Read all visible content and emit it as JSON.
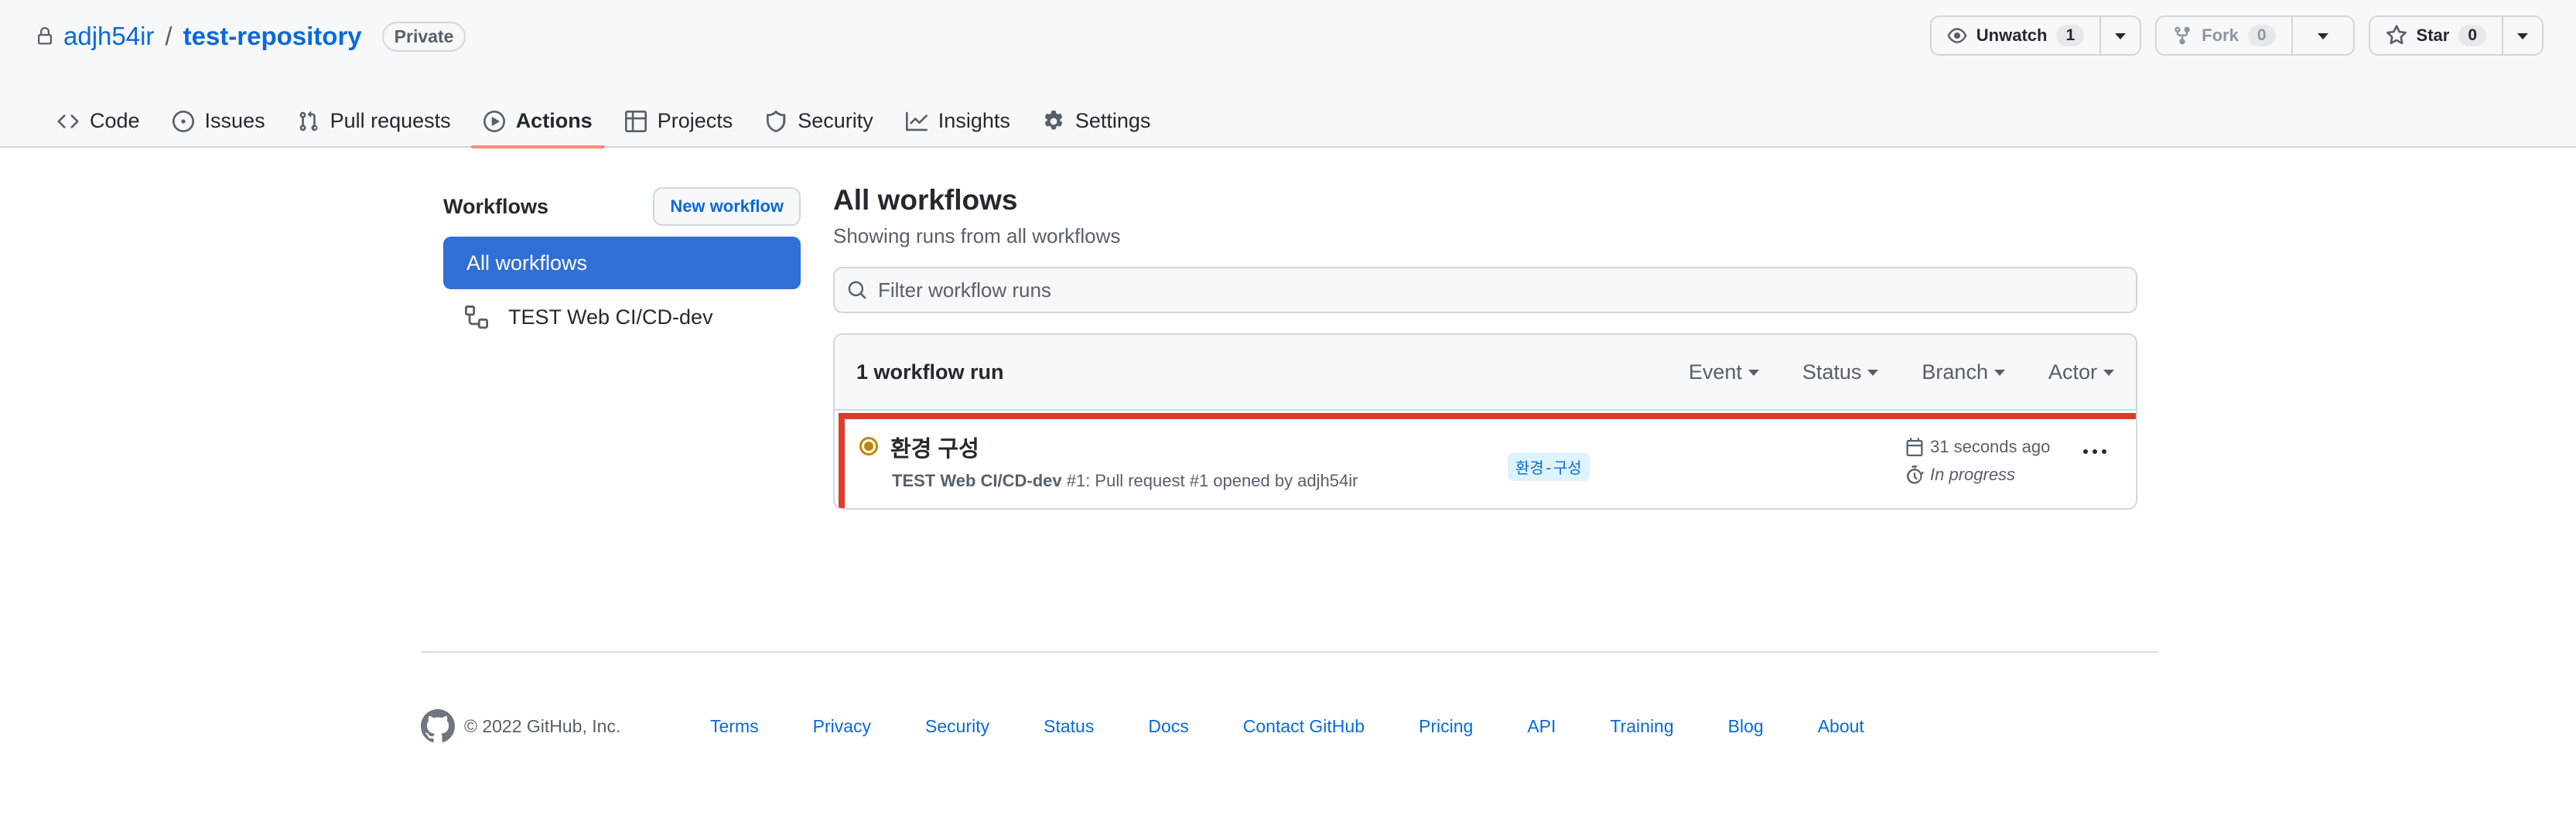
{
  "repo": {
    "owner": "adjh54ir",
    "separator": "/",
    "name": "test-repository",
    "visibility": "Private"
  },
  "header_actions": {
    "watch": {
      "label": "Unwatch",
      "count": "1"
    },
    "fork": {
      "label": "Fork",
      "count": "0"
    },
    "star": {
      "label": "Star",
      "count": "0"
    }
  },
  "tabs": [
    {
      "label": "Code",
      "icon": "code-icon"
    },
    {
      "label": "Issues",
      "icon": "issue-opened-icon"
    },
    {
      "label": "Pull requests",
      "icon": "git-pull-request-icon"
    },
    {
      "label": "Actions",
      "icon": "play-icon",
      "selected": true
    },
    {
      "label": "Projects",
      "icon": "table-icon"
    },
    {
      "label": "Security",
      "icon": "shield-icon"
    },
    {
      "label": "Insights",
      "icon": "graph-icon"
    },
    {
      "label": "Settings",
      "icon": "gear-icon"
    }
  ],
  "sidebar": {
    "title": "Workflows",
    "new_workflow": "New workflow",
    "all_workflows": "All workflows",
    "items": [
      {
        "label": "TEST Web CI/CD-dev",
        "icon": "workflow-icon"
      }
    ]
  },
  "main": {
    "title": "All workflows",
    "subtitle": "Showing runs from all workflows",
    "filter_placeholder": "Filter workflow runs",
    "runs_count": "1 workflow run",
    "filters": [
      "Event",
      "Status",
      "Branch",
      "Actor"
    ]
  },
  "runs": [
    {
      "title": "환경 구성",
      "workflow": "TEST Web CI/CD-dev",
      "meta_rest": " #1: Pull request #1 opened by adjh54ir",
      "branch": "환경-구성",
      "time": "31 seconds ago",
      "duration": "In progress",
      "status_color": "#bf8700"
    }
  ],
  "footer": {
    "copyright": "© 2022 GitHub, Inc.",
    "links": [
      "Terms",
      "Privacy",
      "Security",
      "Status",
      "Docs",
      "Contact GitHub",
      "Pricing",
      "API",
      "Training",
      "Blog",
      "About"
    ]
  },
  "colors": {
    "accent": "#0969da",
    "active_nav": "#2f6fd6",
    "tab_underline": "#fd8c73",
    "highlight_box": "#e03a2a"
  }
}
